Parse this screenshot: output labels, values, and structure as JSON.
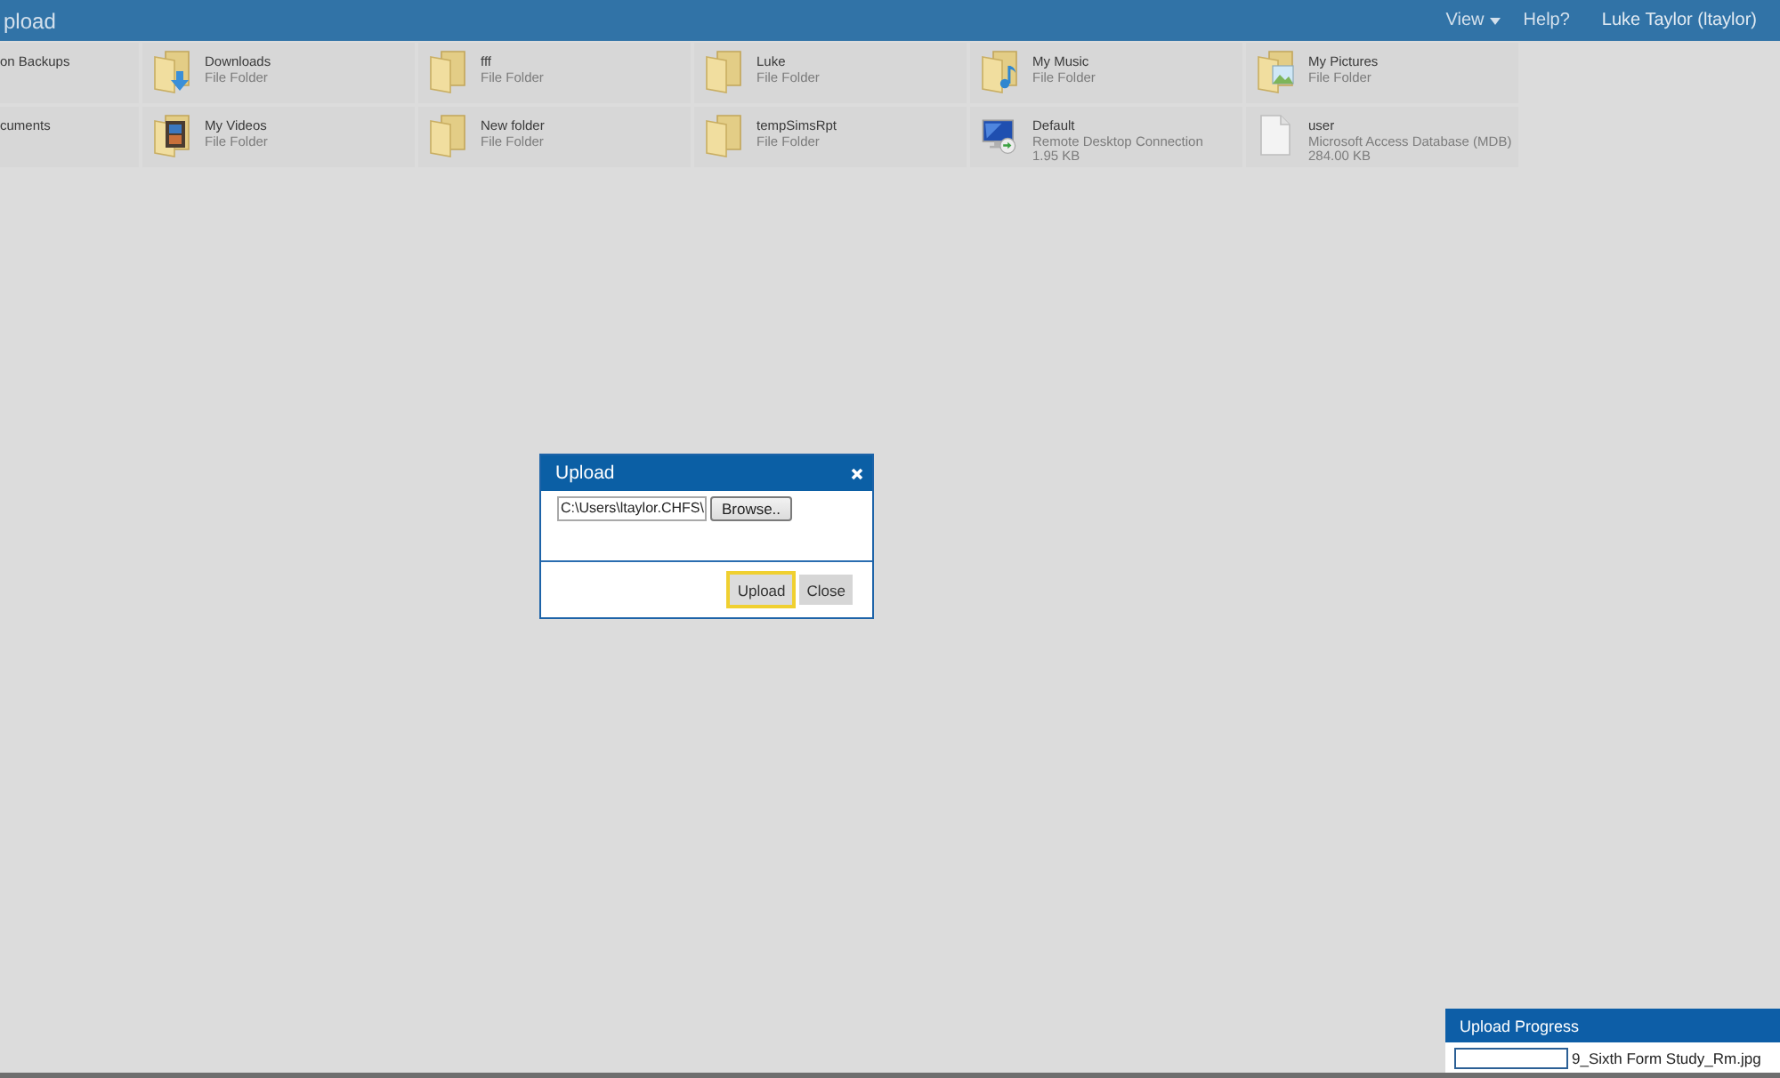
{
  "header": {
    "title": "pload",
    "menus": [
      {
        "label": "View",
        "dropdown": true
      },
      {
        "label": "Help?",
        "dropdown": false
      }
    ],
    "user": "Luke Taylor (ltaylor)"
  },
  "files": [
    {
      "kind": "clipped",
      "name": "on Backups"
    },
    {
      "kind": "download-folder",
      "name": "Downloads",
      "type": "File Folder"
    },
    {
      "kind": "folder",
      "name": "fff",
      "type": "File Folder"
    },
    {
      "kind": "folder",
      "name": "Luke",
      "type": "File Folder"
    },
    {
      "kind": "music-folder",
      "name": "My Music",
      "type": "File Folder"
    },
    {
      "kind": "picture-folder",
      "name": "My Pictures",
      "type": "File Folder"
    },
    {
      "kind": "clipped",
      "name": "cuments"
    },
    {
      "kind": "video-folder",
      "name": "My Videos",
      "type": "File Folder"
    },
    {
      "kind": "folder",
      "name": "New folder",
      "type": "File Folder"
    },
    {
      "kind": "folder",
      "name": "tempSimsRpt",
      "type": "File Folder"
    },
    {
      "kind": "remote-desktop",
      "name": "Default",
      "type": "Remote Desktop Connection",
      "size": "1.95 KB"
    },
    {
      "kind": "file",
      "name": "user",
      "type": "Microsoft Access Database (MDB)",
      "size": "284.00 KB"
    }
  ],
  "dialog": {
    "title": "Upload",
    "file_path": "C:\\Users\\ltaylor.CHFS\\",
    "browse_label": "Browse..",
    "buttons": [
      {
        "label": "Upload",
        "focused": true
      },
      {
        "label": "Close",
        "focused": false
      }
    ]
  },
  "upload_progress": {
    "title": "Upload Progress",
    "items": [
      {
        "file": "9_Sixth Form Study_Rm.jpg",
        "level": 0
      }
    ]
  }
}
